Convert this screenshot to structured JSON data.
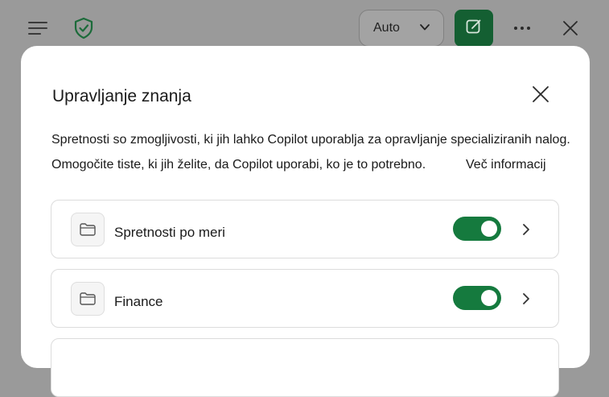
{
  "header": {
    "model_selector_value": "Auto",
    "icons": {
      "menu": "hamburger-menu-icon",
      "shield": "shield-check-icon",
      "new_chat": "compose-icon",
      "more": "more-options-icon",
      "close": "close-icon"
    }
  },
  "colors": {
    "accent": "#157a3e",
    "new_chat_bg": "#145f32",
    "overlay": "#9a9a9a",
    "card_border": "#dcdcdc"
  },
  "dialog": {
    "title": "Upravljanje znanja",
    "description_line1": "Spretnosti so zmogljivosti, ki jih lahko Copilot uporablja za opravljanje specializiranih nalog.",
    "description_line2": "Omogočite tiste, ki jih želite, da Copilot uporabi, ko je to potrebno.",
    "learn_more": "Več informacij",
    "skills": [
      {
        "label": "Spretnosti po meri",
        "enabled": true,
        "icon": "folder-icon"
      },
      {
        "label": "Finance",
        "enabled": true,
        "icon": "folder-icon"
      }
    ]
  }
}
